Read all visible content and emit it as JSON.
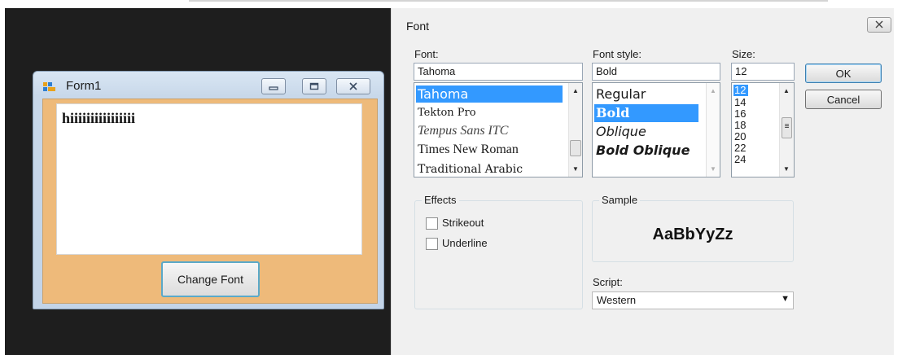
{
  "form1": {
    "title": "Form1",
    "text_content": "hiiiiiiiiiiiiiiii",
    "change_font_button": "Change Font",
    "colors": {
      "client_background": "#eeba7a",
      "button_focus_border": "#5aa9c9"
    }
  },
  "font_dialog": {
    "title": "Font",
    "close_glyph": "✕",
    "font_label": "Font:",
    "font_value": "Tahoma",
    "font_list": [
      "Tahoma",
      "Tekton Pro",
      "Tempus Sans ITC",
      "Times New Roman",
      "Traditional Arabic"
    ],
    "font_selected": "Tahoma",
    "style_label": "Font style:",
    "style_value": "Bold",
    "style_list": [
      "Regular",
      "Bold",
      "Oblique",
      "Bold Oblique"
    ],
    "style_selected": "Bold",
    "size_label": "Size:",
    "size_value": "12",
    "size_list": [
      "12",
      "14",
      "16",
      "18",
      "20",
      "22",
      "24"
    ],
    "size_selected": "12",
    "ok_button": "OK",
    "cancel_button": "Cancel",
    "effects": {
      "label": "Effects",
      "strikeout_label": "Strikeout",
      "strikeout_checked": false,
      "underline_label": "Underline",
      "underline_checked": false
    },
    "sample": {
      "label": "Sample",
      "text": "AaBbYyZz"
    },
    "script": {
      "label": "Script:",
      "value": "Western"
    },
    "colors": {
      "selection": "#3399ff",
      "dialog_background": "#f0f0f0"
    }
  },
  "icons": [
    "form-app-icon",
    "minimize-icon",
    "maximize-icon",
    "close-icon",
    "scroll-up-icon",
    "scroll-down-icon",
    "dropdown-arrow-icon"
  ]
}
